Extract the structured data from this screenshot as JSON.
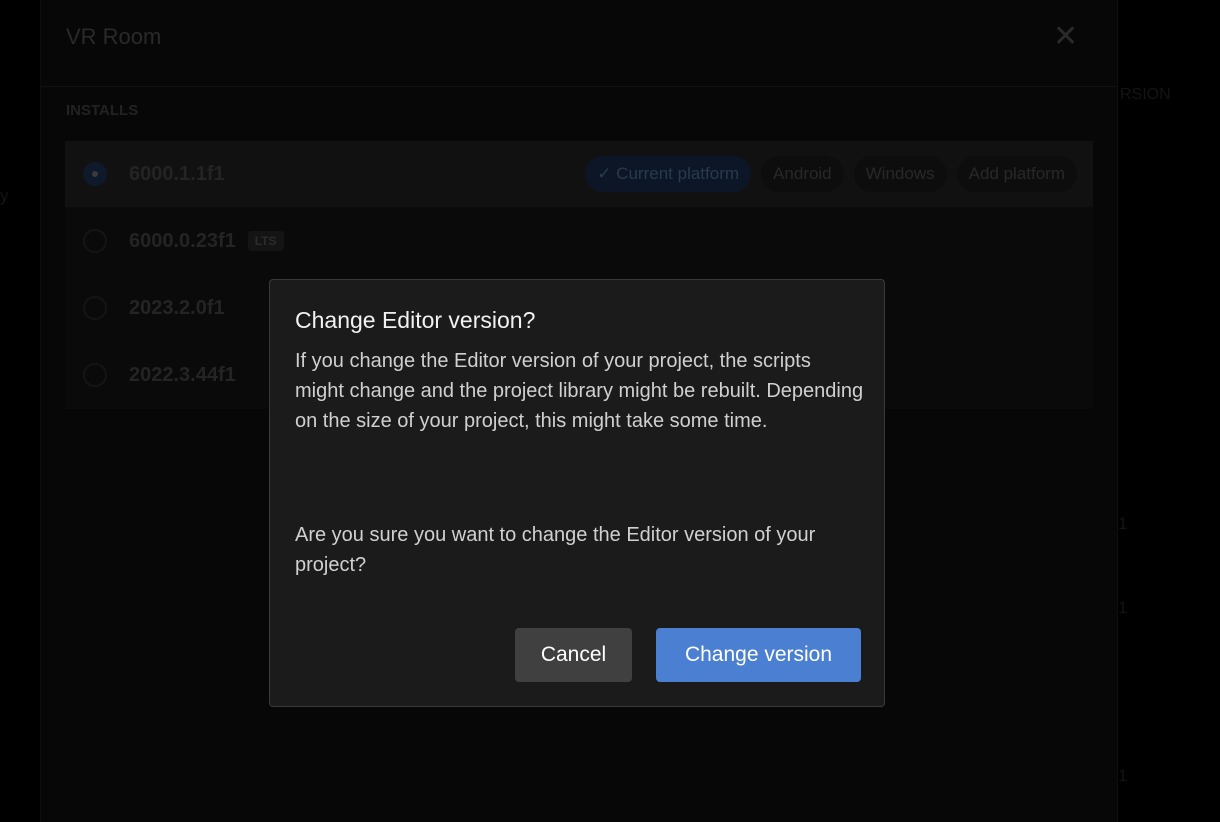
{
  "background": {
    "left_fragment": "y",
    "right_header_fragment": "RSION",
    "right_fragments": [
      "1",
      "1",
      "1"
    ]
  },
  "panel": {
    "title": "VR Room",
    "close_icon": "close-icon",
    "section_label": "INSTALLS",
    "installs": [
      {
        "version": "6000.1.1f1",
        "selected": true,
        "badge": null
      },
      {
        "version": "6000.0.23f1",
        "selected": false,
        "badge": "LTS"
      },
      {
        "version": "2023.2.0f1",
        "selected": false,
        "badge": null
      },
      {
        "version": "2022.3.44f1",
        "selected": false,
        "badge": null
      }
    ],
    "platforms": {
      "current": "Current platform",
      "android": "Android",
      "windows": "Windows",
      "add": "Add platform"
    }
  },
  "dialog": {
    "title": "Change Editor version?",
    "body": "If you change the Editor version of your project, the scripts might change and the project library might be rebuilt. Depending on the size of your project, this might take some time.",
    "question": "Are you sure you want to change the Editor version of your project?",
    "cancel_label": "Cancel",
    "confirm_label": "Change version",
    "accent": "#4a7fd1"
  }
}
